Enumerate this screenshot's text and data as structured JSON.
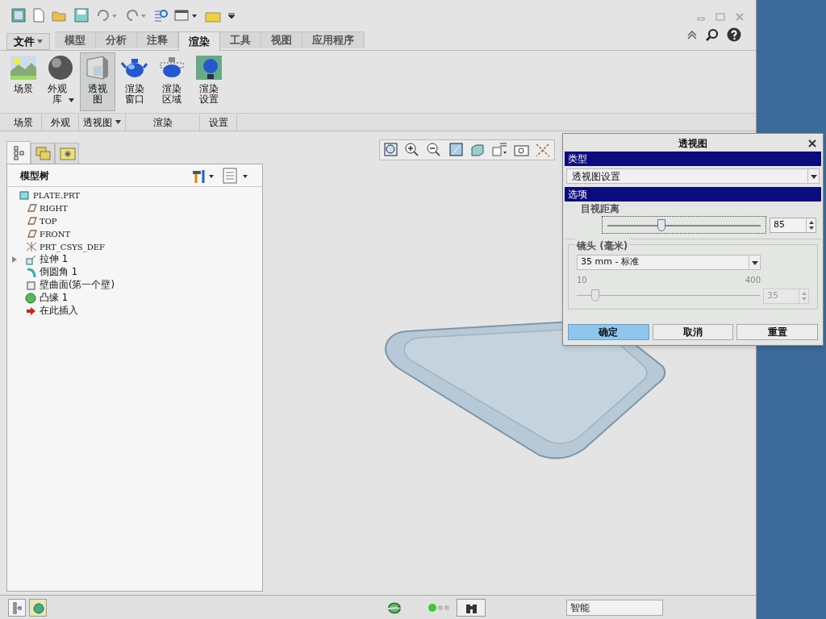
{
  "ribbon": {
    "file_menu": "文件",
    "tabs": [
      {
        "label": "模型",
        "selected": false
      },
      {
        "label": "分析",
        "selected": false
      },
      {
        "label": "注释",
        "selected": false
      },
      {
        "label": "渲染",
        "selected": true
      },
      {
        "label": "工具",
        "selected": false
      },
      {
        "label": "视图",
        "selected": false
      },
      {
        "label": "应用程序",
        "selected": false
      }
    ],
    "buttons": [
      {
        "label": "场景",
        "kind": "scene",
        "selected": false,
        "dropdown": false
      },
      {
        "label": "外观库",
        "kind": "sphere",
        "selected": false,
        "dropdown": true
      },
      {
        "label": "透视图",
        "kind": "perspective",
        "selected": true,
        "dropdown": false
      },
      {
        "label": "渲染窗口",
        "kind": "teapot",
        "selected": false,
        "dropdown": false
      },
      {
        "label": "渲染区域",
        "kind": "teapot-region",
        "selected": false,
        "dropdown": false
      },
      {
        "label": "渲染设置",
        "kind": "settings",
        "selected": false,
        "dropdown": false
      }
    ],
    "groups": [
      {
        "label": "场景",
        "dropdown": false
      },
      {
        "label": "外观",
        "dropdown": false
      },
      {
        "label": "透视图",
        "dropdown": true
      },
      {
        "label": "渲染",
        "dropdown": false
      },
      {
        "label": "设置",
        "dropdown": false
      }
    ]
  },
  "model_tree": {
    "title": "模型树",
    "items": [
      {
        "label": "PLATE.PRT",
        "kind": "part",
        "has_children": false,
        "mono": true
      },
      {
        "label": "RIGHT",
        "kind": "plane",
        "has_children": false,
        "mono": true
      },
      {
        "label": "TOP",
        "kind": "plane",
        "has_children": false,
        "mono": true
      },
      {
        "label": "FRONT",
        "kind": "plane",
        "has_children": false,
        "mono": true
      },
      {
        "label": "PRT_CSYS_DEF",
        "kind": "csys",
        "has_children": false,
        "mono": true
      },
      {
        "label": "拉伸 1",
        "kind": "extrude",
        "has_children": true,
        "mono": false
      },
      {
        "label": "倒圆角 1",
        "kind": "round",
        "has_children": false,
        "mono": false
      },
      {
        "label": "壁曲面(第一个壁)",
        "kind": "wall",
        "has_children": false,
        "mono": false
      },
      {
        "label": "凸缘 1",
        "kind": "flange",
        "has_children": false,
        "mono": false
      },
      {
        "label": "在此插入",
        "kind": "insert",
        "has_children": false,
        "mono": false
      }
    ]
  },
  "dialog": {
    "title": "透视图",
    "type_header": "类型",
    "type_value": "透视图设置",
    "options_header": "选项",
    "eye_distance": {
      "label": "目视距离",
      "level": 0.36,
      "value": "85"
    },
    "lens": {
      "label": "镜头 (毫米)",
      "value": "35 mm - 标准",
      "min": "10",
      "max": "400",
      "level": 0.1,
      "value_field": "35",
      "disabled": true
    },
    "buttons": [
      {
        "label": "确定",
        "primary": true
      },
      {
        "label": "取消",
        "primary": false
      },
      {
        "label": "重置",
        "primary": false
      }
    ]
  },
  "status_bar": {
    "filter": "智能"
  }
}
